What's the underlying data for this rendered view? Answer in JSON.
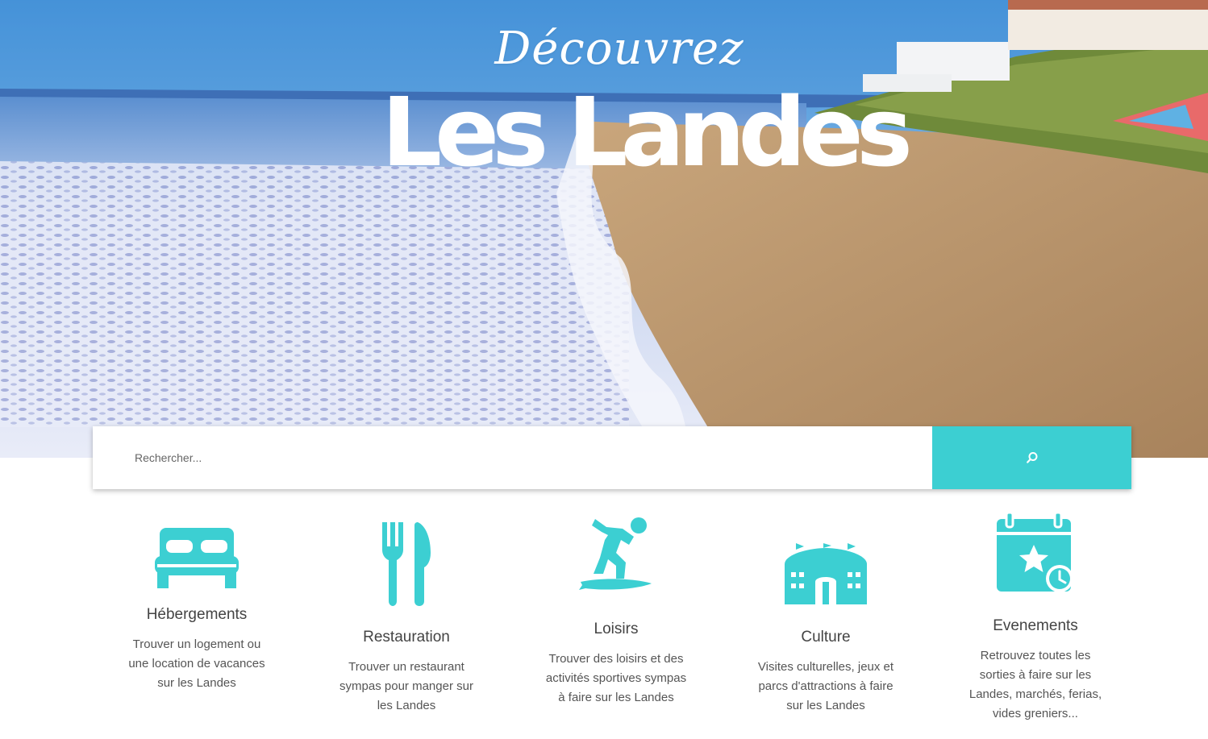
{
  "hero": {
    "kicker": "Découvrez",
    "title": "Les Landes"
  },
  "search": {
    "placeholder": "Rechercher..."
  },
  "categories": [
    {
      "title": "Hébergements",
      "description": "Trouver un logement ou une location de vacances sur les Landes",
      "icon": "bed-icon"
    },
    {
      "title": "Restauration",
      "description": "Trouver un restaurant sympas pour manger sur les Landes",
      "icon": "fork-knife-icon"
    },
    {
      "title": "Loisirs",
      "description": "Trouver des loisirs et des activités sportives sympas à faire sur les Landes",
      "icon": "surfer-icon"
    },
    {
      "title": "Culture",
      "description": "Visites culturelles, jeux et parcs d'attractions à faire sur les Landes",
      "icon": "arena-icon"
    },
    {
      "title": "Evenements",
      "description": "Retrouvez toutes les sorties à faire sur les Landes, marchés, ferias, vides greniers...",
      "icon": "calendar-star-icon"
    }
  ],
  "colors": {
    "accent": "#3ccfd2",
    "text": "#555555",
    "heading": "#444444"
  }
}
